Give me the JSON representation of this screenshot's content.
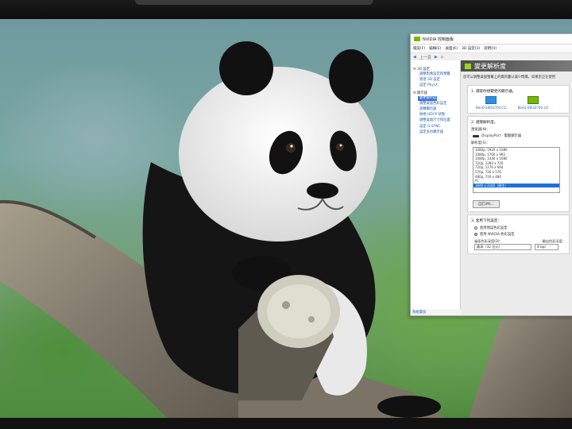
{
  "window": {
    "title": "NVIDIA 控制面板",
    "menu": [
      "檔案(F)",
      "編輯(E)",
      "桌面(K)",
      "3D 設定(3)",
      "說明(H)"
    ],
    "toolbar": {
      "back": "◀",
      "back_label": "上一頁",
      "forward": "▶"
    }
  },
  "tree": {
    "groups": [
      {
        "label": "3D 設定",
        "items": [
          "調整影像設定和預覽",
          "管理 3D 設定",
          "設定 PhysX"
        ]
      },
      {
        "label": "顯示器",
        "items": [
          "變更解析度",
          "調整桌面色彩設定",
          "旋轉顯示器",
          "檢視 HDCP 狀態",
          "調整桌面尺寸和位置",
          "設定 G-SYNC",
          "設定多台顯示器"
        ]
      }
    ],
    "selected": "變更解析度",
    "system_info": "系統資訊"
  },
  "main": {
    "heading": "變更解析度",
    "description": "您可以調整桌面螢幕上的資訊量以減少閃爍，如果您正在使用",
    "section1": {
      "title": "1. 選取你想變更的顯示器。",
      "monitors": [
        "BenQ EW3270U (1)",
        "BenQ EW3270U (2)"
      ]
    },
    "section2": {
      "title": "2. 選擇解析度。",
      "connector_label": "連接器(N)：",
      "connector_value": "DisplayPort - 電腦顯示器",
      "resolution_label": "解析度(S)：",
      "resolutions": [
        "1080p, 1920 x 1080",
        "1080p, 1760 x 992",
        "1080p, 1440 x 1080",
        "720p, 1280 x 720",
        "720p, 1176 x 664",
        "576p, 720 x 576",
        "480p, 720 x 480",
        "PC",
        "3840 x 2160（原生）"
      ],
      "selected_index": 8,
      "customize_button": "自訂(M)..."
    },
    "section3": {
      "title": "3. 套用下列設定：",
      "options": [
        "使用預設色彩設定",
        "使用 NVIDIA 色彩設定"
      ],
      "selected_option": 1,
      "desktop_color_label": "桌面色彩深度(D)：",
      "output_color_label": "輸出色彩深度：",
      "desktop_color_value": "最高（32 位元）",
      "output_color_value": "8 bpc"
    }
  }
}
